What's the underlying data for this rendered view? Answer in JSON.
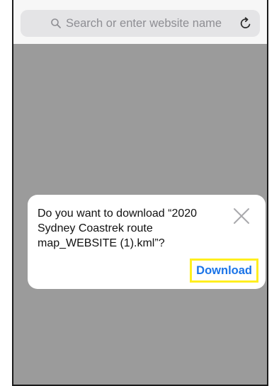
{
  "browser": {
    "address_bar": {
      "placeholder": "Search or enter website name"
    },
    "icons": {
      "search": "magnifier-icon",
      "reload": "reload-icon"
    }
  },
  "dialog": {
    "message": "Do you want to download “2020 Sydney Coastrek route map_WEBSITE (1).kml”?",
    "download_label": "Download",
    "close_icon": "close-x-icon"
  },
  "colors": {
    "page_background": "#9b9b9b",
    "address_bar": "#e4e4e6",
    "link_blue": "#1a74e8",
    "highlight_yellow": "#ffef1f"
  }
}
